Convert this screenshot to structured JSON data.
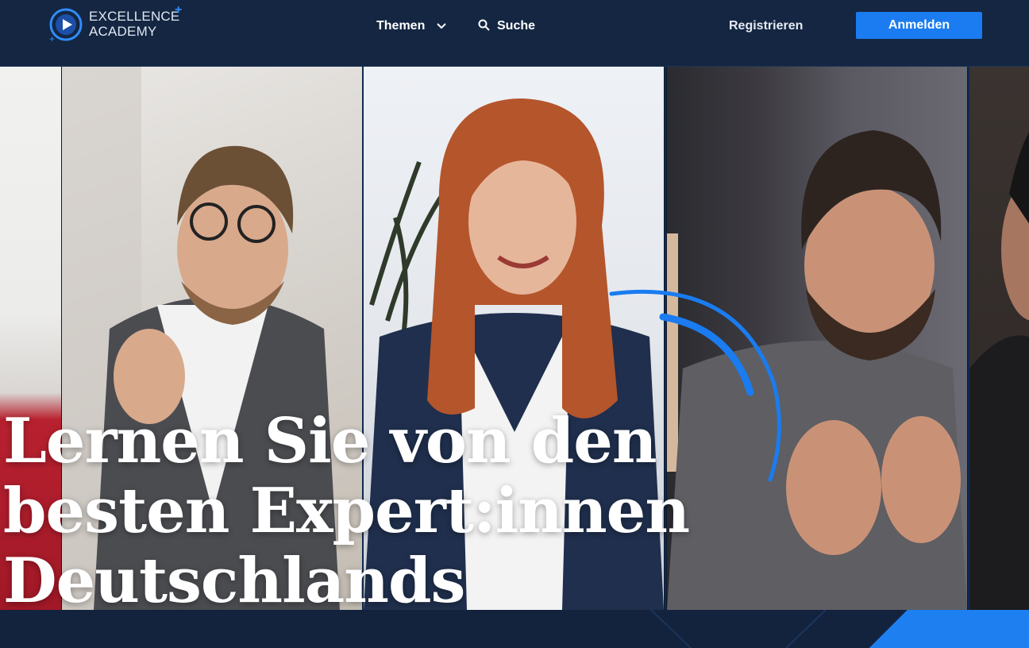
{
  "header": {
    "logo_line1": "EXCELLENCE",
    "logo_line2": "ACADEMY",
    "nav": {
      "themen": "Themen",
      "suche": "Suche",
      "registrieren": "Registrieren",
      "anmelden": "Anmelden"
    }
  },
  "hero": {
    "headline": "Lernen Sie von den besten Expert:innen Deutschlands"
  },
  "colors": {
    "header_bg": "#142641",
    "accent": "#1a7cf0",
    "text": "#ffffff"
  },
  "icons": [
    "logo-play-icon",
    "chevron-down-icon",
    "search-icon"
  ]
}
